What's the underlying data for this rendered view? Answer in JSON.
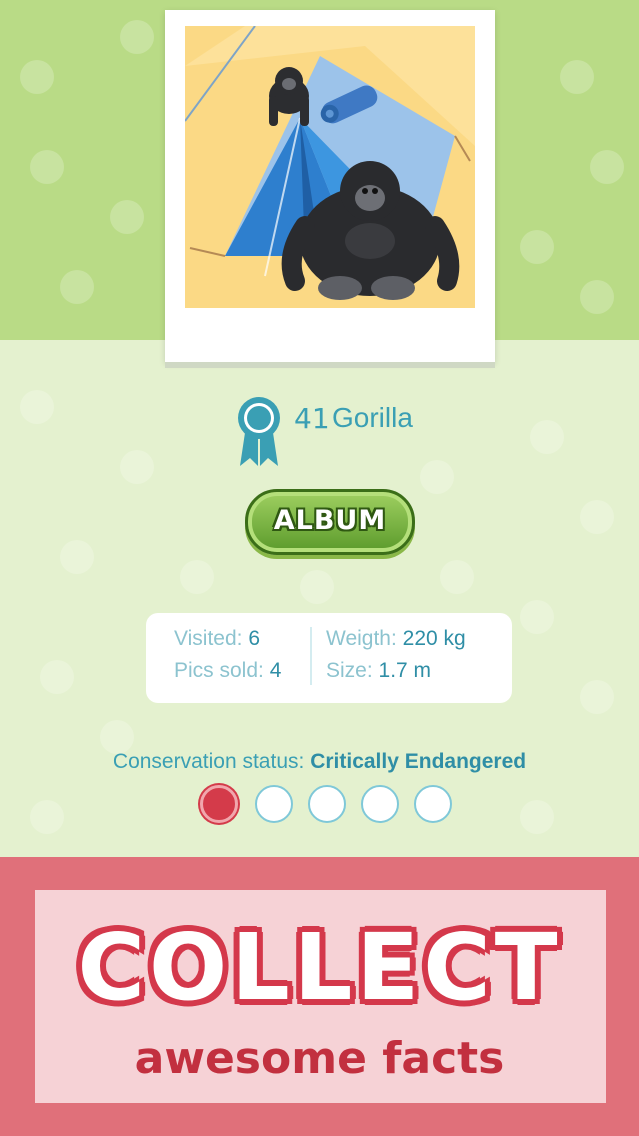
{
  "species": {
    "count": "41",
    "name": "Gorilla"
  },
  "album_button": {
    "label": "ALBUM"
  },
  "stats": {
    "visited_label": "Visited:",
    "visited_value": "6",
    "pics_label": "Pics sold:",
    "pics_value": "4",
    "weight_label": "Weigth:",
    "weight_value": "220 kg",
    "size_label": "Size:",
    "size_value": "1.7 m"
  },
  "conservation": {
    "label": "Conservation status:",
    "value": "Critically Endangered",
    "level": 1,
    "levels_total": 5
  },
  "banner": {
    "headline": "COLLECT",
    "subline": "awesome facts"
  },
  "colors": {
    "accent": "#3a9fb4",
    "danger": "#d43b4a",
    "top_bg": "#b9db86",
    "mid_bg": "#e4f1cf",
    "bottom_bg": "#e0707a"
  },
  "icons": [
    "ribbon-award-icon",
    "gorilla-illustration",
    "tent-illustration"
  ]
}
